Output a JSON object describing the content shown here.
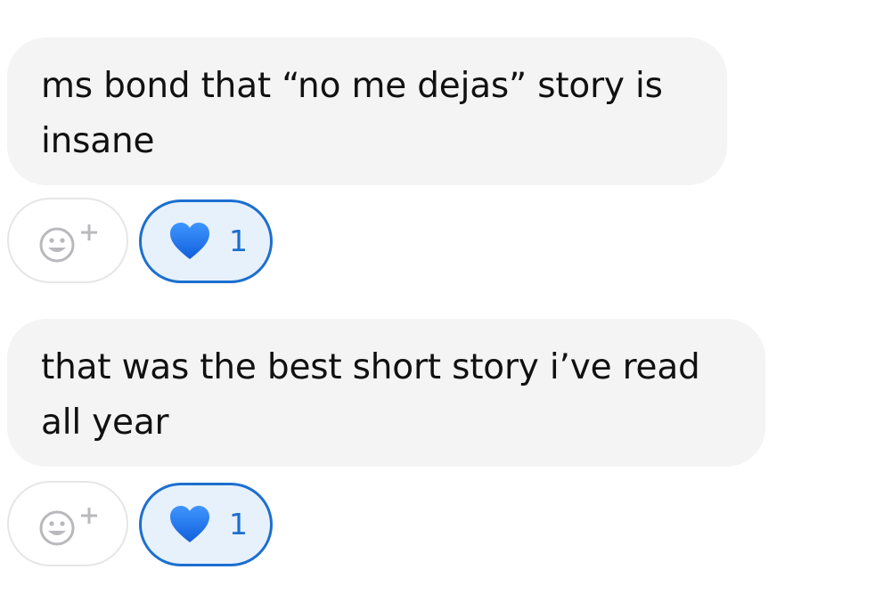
{
  "messages": [
    {
      "text": "ms bond that “no me dejas” story is insane",
      "reactions": [
        {
          "icon": "blue-heart-icon",
          "count": "1",
          "selected": true
        }
      ]
    },
    {
      "text": "that was the best short story i’ve read all year",
      "reactions": [
        {
          "icon": "blue-heart-icon",
          "count": "1",
          "selected": true
        }
      ]
    }
  ],
  "add_reaction_icon": "add-reaction-icon",
  "colors": {
    "bubble_bg": "#f4f4f5",
    "text": "#111111",
    "reaction_accent": "#1c6fcf",
    "reaction_selected_bg": "#e7f1fc",
    "heart_fill": "#1f7bf2",
    "add_reaction_border": "#e6e6e8",
    "add_reaction_icon": "#b9b9bd"
  }
}
